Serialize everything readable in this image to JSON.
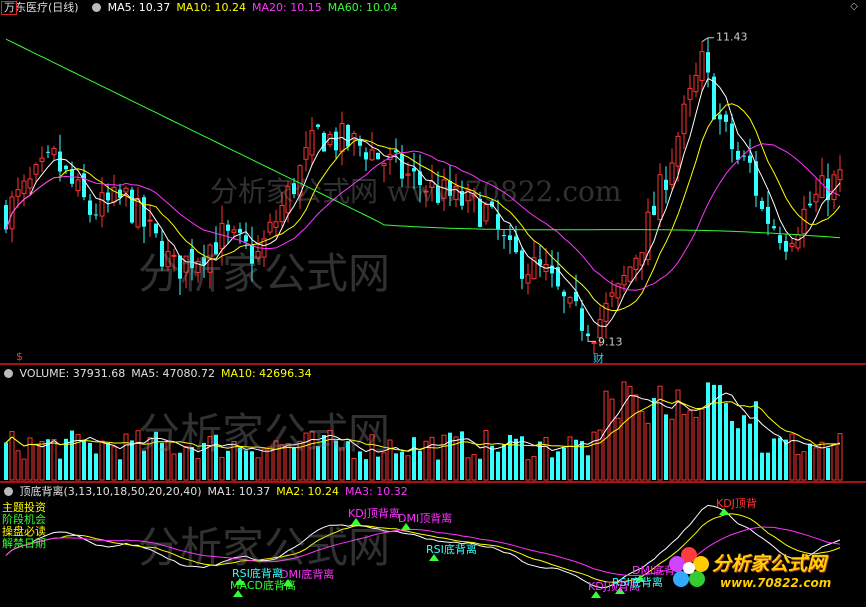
{
  "header": {
    "stock_name": "万东医疗(日线)",
    "ma": [
      {
        "label": "MA5: 10.37",
        "color": "#ffffff"
      },
      {
        "label": "MA10: 10.24",
        "color": "#ffff00"
      },
      {
        "label": "MA20: 10.15",
        "color": "#ff33ff"
      },
      {
        "label": "MA60: 10.04",
        "color": "#33ff33"
      }
    ]
  },
  "price_panel": {
    "high_label": "11.43",
    "low_label": "9.13",
    "event_mark": "财",
    "left_mark": "$"
  },
  "volume_panel": {
    "labels": [
      {
        "label": "VOLUME: 37931.68",
        "color": "#e0e0e0"
      },
      {
        "label": "MA5: 47080.72",
        "color": "#e0e0e0"
      },
      {
        "label": "MA10: 42696.34",
        "color": "#ffff00"
      }
    ]
  },
  "indicator_panel": {
    "labels": [
      {
        "label": "顶底背离(3,13,10,18,50,20,20,40)",
        "color": "#e0e0e0"
      },
      {
        "label": "MA1: 10.37",
        "color": "#e0e0e0"
      },
      {
        "label": "MA2: 10.24",
        "color": "#ffff00"
      },
      {
        "label": "MA3: 10.32",
        "color": "#ff33ff"
      }
    ],
    "left_notes": [
      {
        "text": "主题投资",
        "color": "#ffff00"
      },
      {
        "text": "阶段机会",
        "color": "#33ff33"
      },
      {
        "text": "操盘必读",
        "color": "#ffff00"
      },
      {
        "text": "解禁日期",
        "color": "#33ff33"
      }
    ],
    "signals": [
      {
        "text": "KDJ顶背离",
        "color": "#ff33ff",
        "arrow": "up"
      },
      {
        "text": "DMI顶背离",
        "color": "#ff33ff",
        "arrow": "up"
      },
      {
        "text": "RSI底背离",
        "color": "#33ffff",
        "arrow": "up"
      },
      {
        "text": "RSI底背离",
        "color": "#33ffff",
        "arrow": "up"
      },
      {
        "text": "DMI底背离",
        "color": "#ff33ff",
        "arrow": "up"
      },
      {
        "text": "MACD底背离",
        "color": "#33ff33",
        "arrow": "up"
      },
      {
        "text": "KDJ顶背离",
        "color": "#ff33ff",
        "arrow": "up"
      },
      {
        "text": "RSI底背离",
        "color": "#33ffff",
        "arrow": "up"
      },
      {
        "text": "DMI底背",
        "color": "#ff33ff",
        "arrow": "up"
      },
      {
        "text": "KDJ顶背",
        "color": "#ff3333",
        "arrow": "up"
      },
      {
        "text": "KDJ顶背离",
        "color": "#ff33ff",
        "arrow": "up"
      }
    ]
  },
  "watermark": {
    "line1": "分析家公式网 www.70822.com",
    "line2": "分析家公式网"
  },
  "logo": {
    "title": "分析家公式网",
    "url": "www.70822.com"
  },
  "colors": {
    "up": "#ff3333",
    "down": "#33ffff",
    "ma5": "#ffffff",
    "ma10": "#ffff00",
    "ma20": "#ff33ff",
    "ma60": "#33ff33",
    "divider": "#aa1111"
  },
  "chart_data": {
    "type": "candlestick",
    "price_range": [
      9.13,
      11.43
    ],
    "ma_values": {
      "MA5": 10.37,
      "MA10": 10.24,
      "MA20": 10.15,
      "MA60": 10.04
    },
    "volume": 37931.68,
    "volume_ma": {
      "MA5": 47080.72,
      "MA10": 42696.34
    },
    "indicator_ma": {
      "MA1": 10.37,
      "MA2": 10.24,
      "MA3": 10.32
    }
  }
}
